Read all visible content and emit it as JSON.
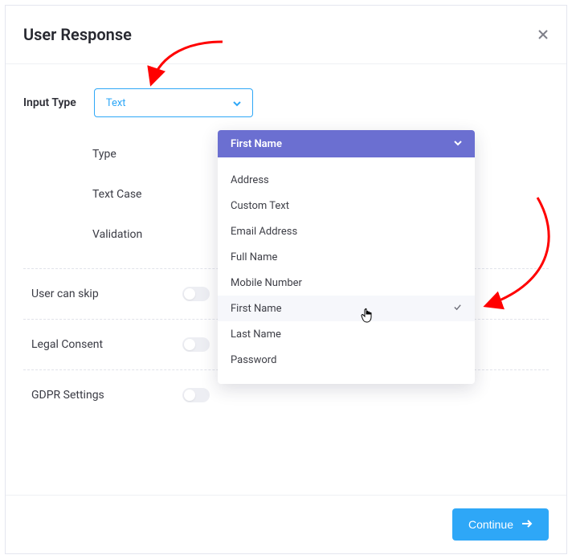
{
  "modal": {
    "title": "User Response"
  },
  "inputType": {
    "label": "Input Type",
    "value": "Text"
  },
  "fields": {
    "type_label": "Type",
    "text_case_label": "Text Case",
    "validation_label": "Validation"
  },
  "dropdown": {
    "selected": "First Name",
    "items": {
      "0": "Address",
      "1": "Custom Text",
      "2": "Email Address",
      "3": "Full Name",
      "4": "Mobile Number",
      "5": "First Name",
      "6": "Last Name",
      "7": "Password"
    },
    "hover_index": 5
  },
  "toggles": {
    "skip_label": "User can skip",
    "consent_label": "Legal Consent",
    "gdpr_label": "GDPR Settings"
  },
  "footer": {
    "continue_label": "Continue"
  },
  "colors": {
    "accent_blue": "#2ea7f7",
    "accent_purple": "#6b6fd1",
    "arrow_red": "#ff0000"
  }
}
